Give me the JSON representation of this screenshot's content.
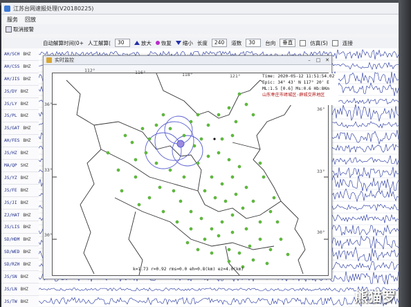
{
  "window": {
    "title": "江苏台网速报处理(V20180225)"
  },
  "menu": {
    "items": [
      "服务",
      "回放"
    ]
  },
  "toolbar": {
    "cancel_label": "取消报警"
  },
  "toolbar2": {
    "auto_label": "自动解算时间(0+",
    "manual_label": "人工解算(",
    "value1": "30",
    "zoom_in": "放大",
    "restore": "恢复",
    "zoom_out": "缩小",
    "length_label": "长度",
    "length_value": "240",
    "track_label": "道数",
    "track_value": "30",
    "dir_label": "台向",
    "dir_value": "垂直",
    "sim_label": "仿真(S)",
    "conn_label": "连接"
  },
  "stations": [
    {
      "code": "AH/SCH",
      "ch": "BHZ"
    },
    {
      "code": "AH/CSS",
      "ch": "BHZ"
    },
    {
      "code": "AH/JIS",
      "ch": "BHZ"
    },
    {
      "code": "JS/DY",
      "ch": "BHZ"
    },
    {
      "code": "JS/LY",
      "ch": "BHZ"
    },
    {
      "code": "JS/PL",
      "ch": "BHZ"
    },
    {
      "code": "JS/GAT",
      "ch": "BHZ"
    },
    {
      "code": "AH/FES",
      "ch": "BHZ"
    },
    {
      "code": "JS/HZ",
      "ch": "BHZ"
    },
    {
      "code": "MA/QP",
      "ch": "SHZ"
    },
    {
      "code": "JS/YZ",
      "ch": "BHZ"
    },
    {
      "code": "JS/FE",
      "ch": "BHZ"
    },
    {
      "code": "JS/JI",
      "ch": "BHZ"
    },
    {
      "code": "ZJ/HAT",
      "ch": "BHZ"
    },
    {
      "code": "JS/LIS",
      "ch": "BHZ"
    },
    {
      "code": "SD/HDM",
      "ch": "BHZ"
    },
    {
      "code": "SD/WED",
      "ch": "BHZ"
    },
    {
      "code": "SD/RZH",
      "ch": "BHZ"
    },
    {
      "code": "JS/SN",
      "ch": "BHZ"
    },
    {
      "code": "JS/LN",
      "ch": "BHZ"
    },
    {
      "code": "JS/TW",
      "ch": "BHZ"
    },
    {
      "code": "ZJ/TW",
      "ch": "BHZ"
    }
  ],
  "popup": {
    "title": "实时监控"
  },
  "map": {
    "top_lon_ticks": [
      "112°",
      "116°",
      "118°",
      "121°"
    ],
    "left_lat_ticks": [
      "36°",
      "33°",
      "30°"
    ],
    "right_lat_ticks": [
      "36°",
      "33°",
      "30°"
    ],
    "info": {
      "time": "Time: 2020-05-12 11:51:54.02",
      "epi": "Epic: 34° 43' N 117° 20' E",
      "mag": "ML:1.5 [0.6] Ms:0.6  Hb:8Km",
      "location": "山东枣庄市峄城区·薛城交界地区"
    },
    "footer": "k=1.73  r=0.92  rms=0.0  eh=0.8(km)  ez=4.0(km)",
    "station_color": "#5fbe3a",
    "epicenter_color": "#5a5fd0"
  },
  "watermark": "熊猫罗"
}
